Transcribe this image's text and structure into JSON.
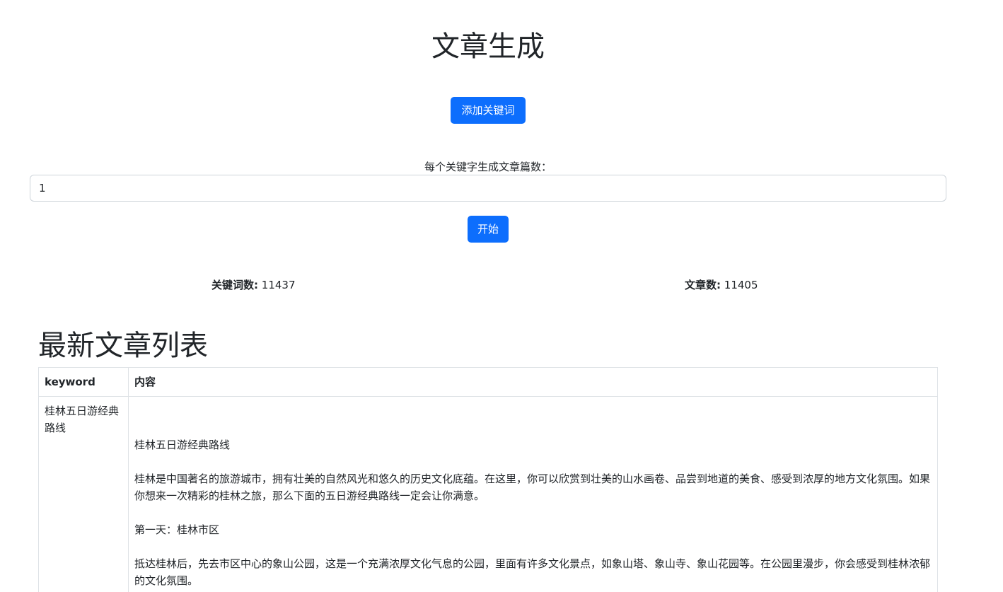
{
  "header": {
    "title": "文章生成"
  },
  "controls": {
    "add_keyword_label": "添加关键词",
    "count_label": "每个关键字生成文章篇数：",
    "count_value": "1",
    "start_label": "开始"
  },
  "stats": {
    "keywords_label": "关键词数:",
    "keywords_value": "11437",
    "articles_label": "文章数:",
    "articles_value": "11405"
  },
  "list": {
    "title": "最新文章列表",
    "columns": [
      "keyword",
      "内容"
    ],
    "rows": [
      {
        "keyword": "桂林五日游经典路线",
        "paragraphs": [
          "桂林五日游经典路线",
          "桂林是中国著名的旅游城市，拥有壮美的自然风光和悠久的历史文化底蕴。在这里，你可以欣赏到壮美的山水画卷、品尝到地道的美食、感受到浓厚的地方文化氛围。如果你想来一次精彩的桂林之旅，那么下面的五日游经典路线一定会让你满意。",
          "第一天：桂林市区",
          "抵达桂林后，先去市区中心的象山公园，这是一个充满浓厚文化气息的公园，里面有许多文化景点，如象山塔、象山寺、象山花园等。在公园里漫步，你会感受到桂林浓郁的文化氛围。"
        ]
      }
    ]
  }
}
